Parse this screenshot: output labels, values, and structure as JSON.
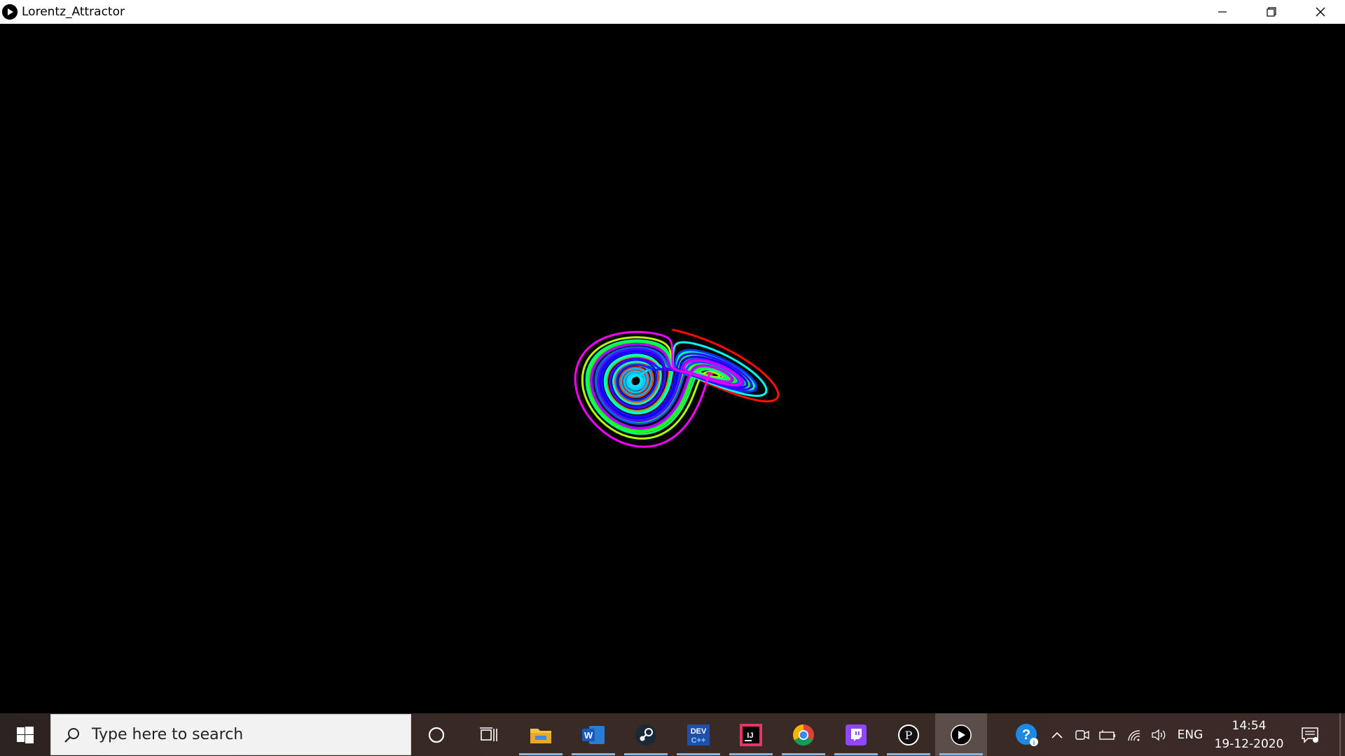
{
  "window": {
    "title": "Lorentz_Attractor"
  },
  "taskbar": {
    "search_placeholder": "Type here to search",
    "apps": [
      {
        "icon": "cortana-icon"
      },
      {
        "icon": "task-view-icon"
      },
      {
        "icon": "file-explorer-icon"
      },
      {
        "icon": "word-icon"
      },
      {
        "icon": "steam-icon"
      },
      {
        "icon": "dev-cpp-icon"
      },
      {
        "icon": "intellij-icon"
      },
      {
        "icon": "chrome-icon"
      },
      {
        "icon": "twitch-icon"
      },
      {
        "icon": "processing-icon"
      },
      {
        "icon": "lorentz-app-icon"
      }
    ],
    "tray": {
      "language": "ENG",
      "time": "14:54",
      "date": "19-12-2020"
    }
  },
  "colors": {
    "background": "#000000",
    "taskbar_bg": "#3a2a26"
  }
}
